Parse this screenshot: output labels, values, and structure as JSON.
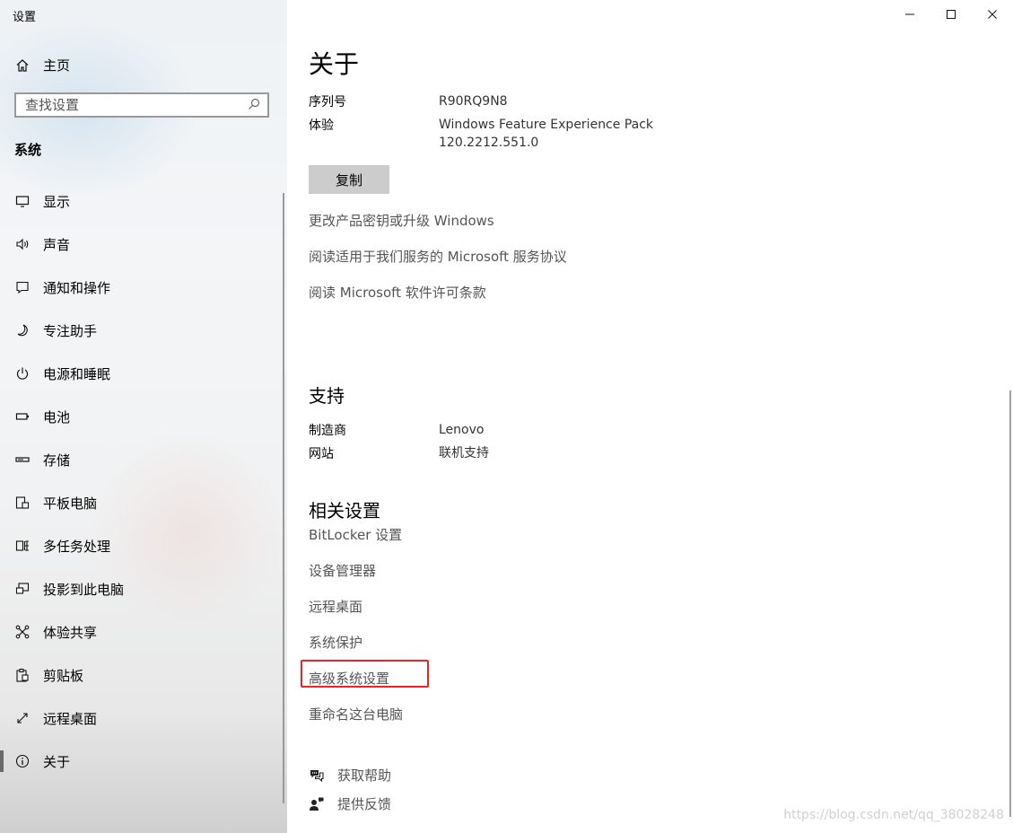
{
  "app_title": "设置",
  "sidebar": {
    "home_label": "主页",
    "search_placeholder": "查找设置",
    "section_label": "系统",
    "items": [
      {
        "label": "显示",
        "icon": "display-icon"
      },
      {
        "label": "声音",
        "icon": "speaker-icon"
      },
      {
        "label": "通知和操作",
        "icon": "notification-icon"
      },
      {
        "label": "专注助手",
        "icon": "moon-icon"
      },
      {
        "label": "电源和睡眠",
        "icon": "power-icon"
      },
      {
        "label": "电池",
        "icon": "battery-icon"
      },
      {
        "label": "存储",
        "icon": "storage-icon"
      },
      {
        "label": "平板电脑",
        "icon": "tablet-icon"
      },
      {
        "label": "多任务处理",
        "icon": "multitask-icon"
      },
      {
        "label": "投影到此电脑",
        "icon": "project-icon"
      },
      {
        "label": "体验共享",
        "icon": "share-icon"
      },
      {
        "label": "剪贴板",
        "icon": "clipboard-icon"
      },
      {
        "label": "远程桌面",
        "icon": "remote-desktop-icon"
      },
      {
        "label": "关于",
        "icon": "info-icon",
        "selected": true
      }
    ]
  },
  "main": {
    "title": "关于",
    "spec": {
      "serial_label": "序列号",
      "serial_value": "R90RQ9N8",
      "experience_label": "体验",
      "experience_value_line1": "Windows Feature Experience Pack",
      "experience_value_line2": "120.2212.551.0"
    },
    "copy_button": "复制",
    "links": [
      "更改产品密钥或升级 Windows",
      "阅读适用于我们服务的 Microsoft 服务协议",
      "阅读 Microsoft 软件许可条款"
    ],
    "support": {
      "title": "支持",
      "manufacturer_label": "制造商",
      "manufacturer_value": "Lenovo",
      "website_label": "网站",
      "website_value": "联机支持"
    },
    "related": {
      "title": "相关设置",
      "items": [
        "BitLocker 设置",
        "设备管理器",
        "远程桌面",
        "系统保护",
        "高级系统设置",
        "重命名这台电脑"
      ],
      "highlighted_item": "高级系统设置",
      "highlight_color": "#e0262b"
    },
    "help": {
      "get_help": "获取帮助",
      "feedback": "提供反馈"
    }
  },
  "watermark": "https://blog.csdn.net/qq_38028248"
}
